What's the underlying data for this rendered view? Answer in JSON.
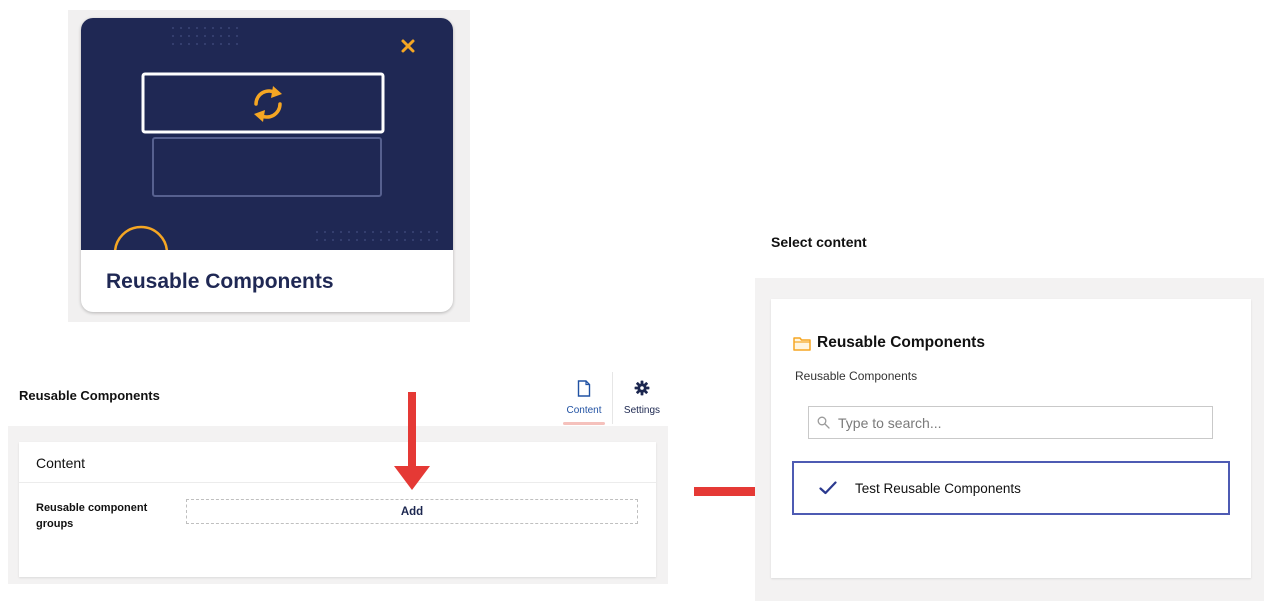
{
  "tile": {
    "title": "Reusable Components",
    "icon": "refresh-icon"
  },
  "editor": {
    "title": "Reusable Components",
    "apps": [
      {
        "label": "Content",
        "icon": "document-icon",
        "active": true
      },
      {
        "label": "Settings",
        "icon": "gear-icon",
        "active": false
      }
    ],
    "group_title": "Content",
    "property_label": "Reusable component groups",
    "add_label": "Add"
  },
  "picker": {
    "title": "Select content",
    "folder_name": "Reusable Components",
    "folder_icon": "folder-icon",
    "breadcrumb": "Reusable Components",
    "search_placeholder": "Type to search...",
    "selected_item": "Test Reusable Components"
  },
  "colors": {
    "tile_bg": "#1f2854",
    "accent_orange": "#f5a623",
    "arrow_red": "#e53935",
    "selection_border": "#4e5bb3",
    "active_tab": "#2152a3"
  }
}
